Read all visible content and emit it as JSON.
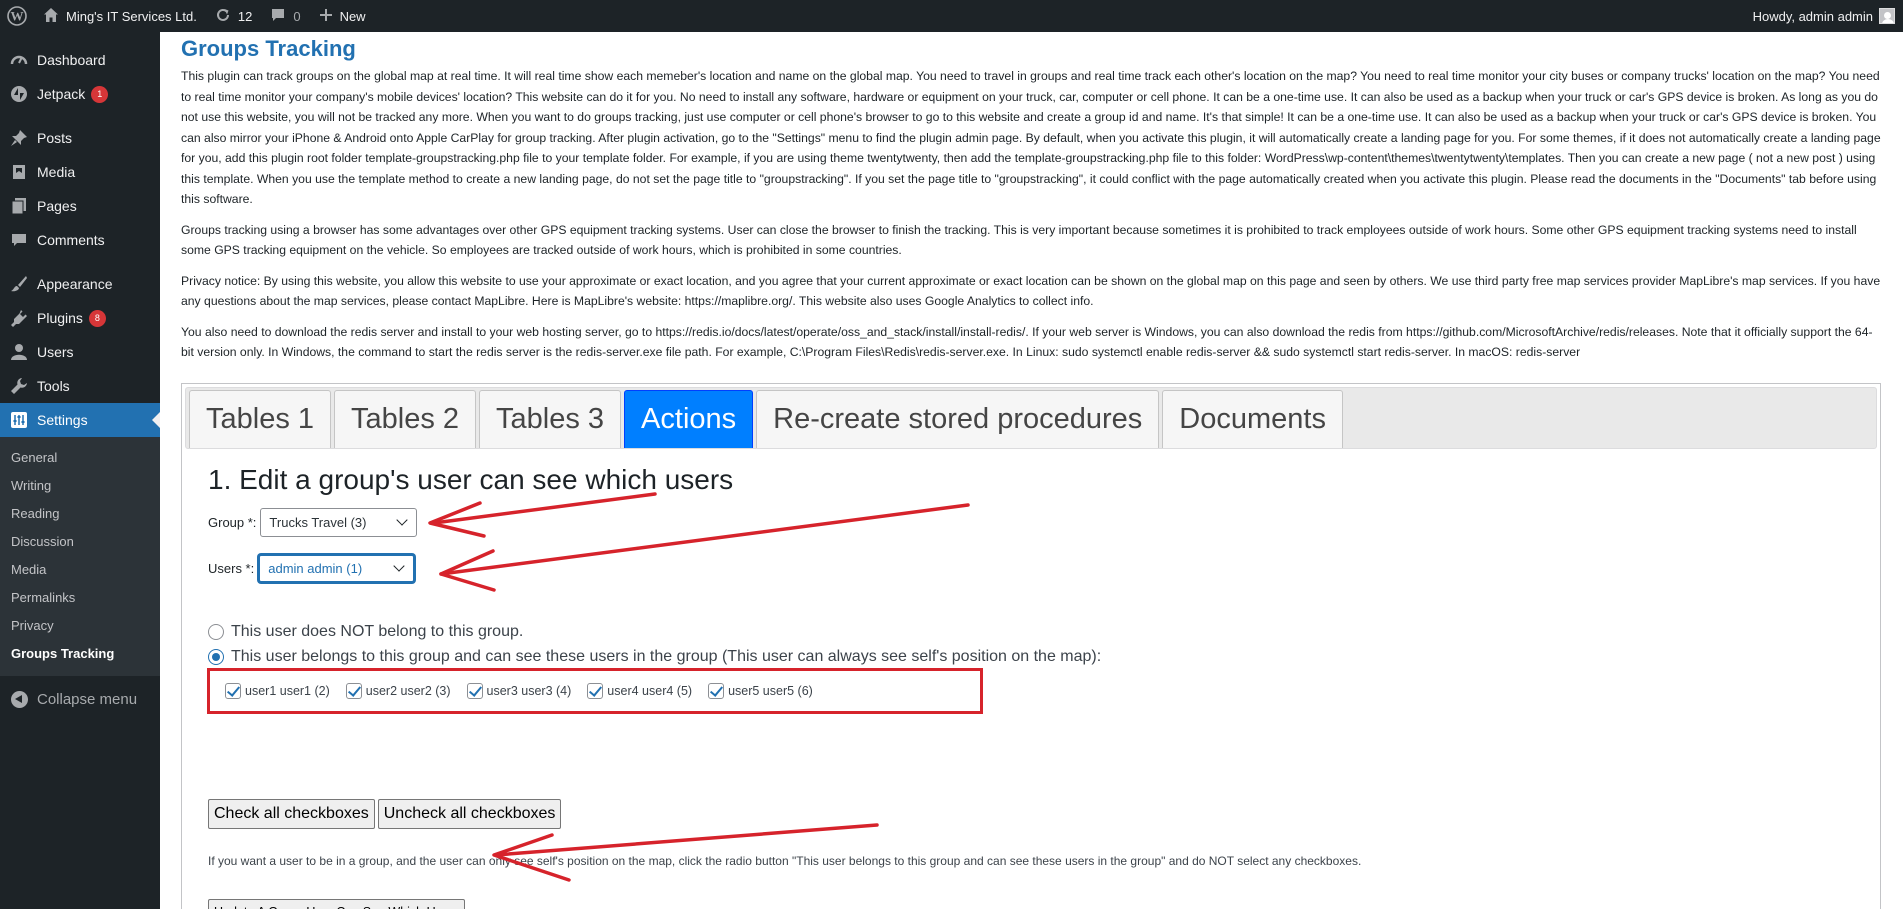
{
  "adminbar": {
    "site_name": "Ming's IT Services Ltd.",
    "updates_count": "12",
    "comments_count": "0",
    "new_label": "New",
    "howdy": "Howdy, admin admin"
  },
  "sidebar": {
    "items": [
      {
        "label": "Dashboard",
        "icon": "dashboard-icon"
      },
      {
        "label": "Jetpack",
        "icon": "jetpack-icon",
        "badge": "1"
      },
      {
        "label": "Posts",
        "icon": "pin-icon"
      },
      {
        "label": "Media",
        "icon": "media-icon"
      },
      {
        "label": "Pages",
        "icon": "pages-icon"
      },
      {
        "label": "Comments",
        "icon": "comment-icon"
      },
      {
        "label": "Appearance",
        "icon": "brush-icon"
      },
      {
        "label": "Plugins",
        "icon": "plugin-icon",
        "badge": "8"
      },
      {
        "label": "Users",
        "icon": "user-icon"
      },
      {
        "label": "Tools",
        "icon": "wrench-icon"
      },
      {
        "label": "Settings",
        "icon": "settings-icon"
      }
    ],
    "submenu": [
      "General",
      "Writing",
      "Reading",
      "Discussion",
      "Media",
      "Permalinks",
      "Privacy",
      "Groups Tracking"
    ],
    "collapse_label": "Collapse menu"
  },
  "page": {
    "title": "Groups Tracking",
    "paragraphs": [
      "This plugin can track groups on the global map at real time. It will real time show each memeber's location and name on the global map. You need to travel in groups and real time track each other's location on the map? You need to real time monitor your city buses or company trucks' location on the map? You need to real time monitor your company's mobile devices' location? This website can do it for you. No need to install any software, hardware or equipment on your truck, car, computer or cell phone. It can be a one-time use. It can also be used as a backup when your truck or car's GPS device is broken. As long as you do not use this website, you will not be tracked any more. When you want to do groups tracking, just use computer or cell phone's browser to go to this website and create a group id and name. It's that simple! It can be a one-time use. It can also be used as a backup when your truck or car's GPS device is broken. You can also mirror your iPhone & Android onto Apple CarPlay for group tracking. After plugin activation, go to the \"Settings\" menu to find the plugin admin page. By default, when you activate this plugin, it will automatically create a landing page for you. For some themes, if it does not automatically create a landing page for you, add this plugin root folder template-groupstracking.php file to your template folder. For example, if you are using theme twentytwenty, then add the template-groupstracking.php file to this folder: WordPress\\wp-content\\themes\\twentytwenty\\templates. Then you can create a new page ( not a new post ) using this template. When you use the template method to create a new landing page, do not set the page title to \"groupstracking\". If you set the page title to \"groupstracking\", it could conflict with the page automatically created when you activate this plugin. Please read the documents in the \"Documents\" tab before using this software.",
      "Groups tracking using a browser has some advantages over other GPS equipment tracking systems. User can close the browser to finish the tracking. This is very important because sometimes it is prohibited to track employees outside of work hours. Some other GPS equipment tracking systems need to install some GPS tracking equipment on the vehicle. So employees are tracked outside of work hours, which is prohibited in some countries.",
      "Privacy notice: By using this website, you allow this website to use your approximate or exact location, and you agree that your current approximate or exact location can be shown on the global map on this page and seen by others. We use third party free map services provider MapLibre's map services. If you have any questions about the map services, please contact MapLibre. Here is MapLibre's website: https://maplibre.org/. This website also uses Google Analytics to collect info.",
      "You also need to download the redis server and install to your web hosting server, go to https://redis.io/docs/latest/operate/oss_and_stack/install/install-redis/. If your web server is Windows, you can also download the redis from https://github.com/MicrosoftArchive/redis/releases. Note that it officially support the 64-bit version only. In Windows, the command to start the redis server is the redis-server.exe file path. For example, C:\\Program Files\\Redis\\redis-server.exe. In Linux: sudo systemctl enable redis-server && sudo systemctl start redis-server. In macOS: redis-server"
    ]
  },
  "tabs": [
    "Tables 1",
    "Tables 2",
    "Tables 3",
    "Actions",
    "Re-create stored procedures",
    "Documents"
  ],
  "form": {
    "heading": "1. Edit a group's user can see which users",
    "group_label": "Group *:",
    "group_value": "Trucks Travel (3)",
    "users_label": "Users *:",
    "users_value": "admin admin (1)",
    "radio_not_belong": "This user does NOT belong to this group.",
    "radio_belongs": "This user belongs to this group and can see these users in the group (This user can always see self's position on the map):",
    "checkboxes": [
      "user1 user1 (2)",
      "user2 user2 (3)",
      "user3 user3 (4)",
      "user4 user4 (5)",
      "user5 user5 (6)"
    ],
    "check_all": "Check all checkboxes",
    "uncheck_all": "Uncheck all checkboxes",
    "note": "If you want a user to be in a group, and the user can only see self's position on the map, click the radio button \"This user belongs to this group and can see these users in the group\" and do NOT select any checkboxes.",
    "update_button": "Update A Group User Can See Which Users"
  },
  "colors": {
    "accent": "#2271b1",
    "active_tab": "#007fff",
    "annotation_red": "#d6232b",
    "sidebar_bg": "#1d2327"
  }
}
